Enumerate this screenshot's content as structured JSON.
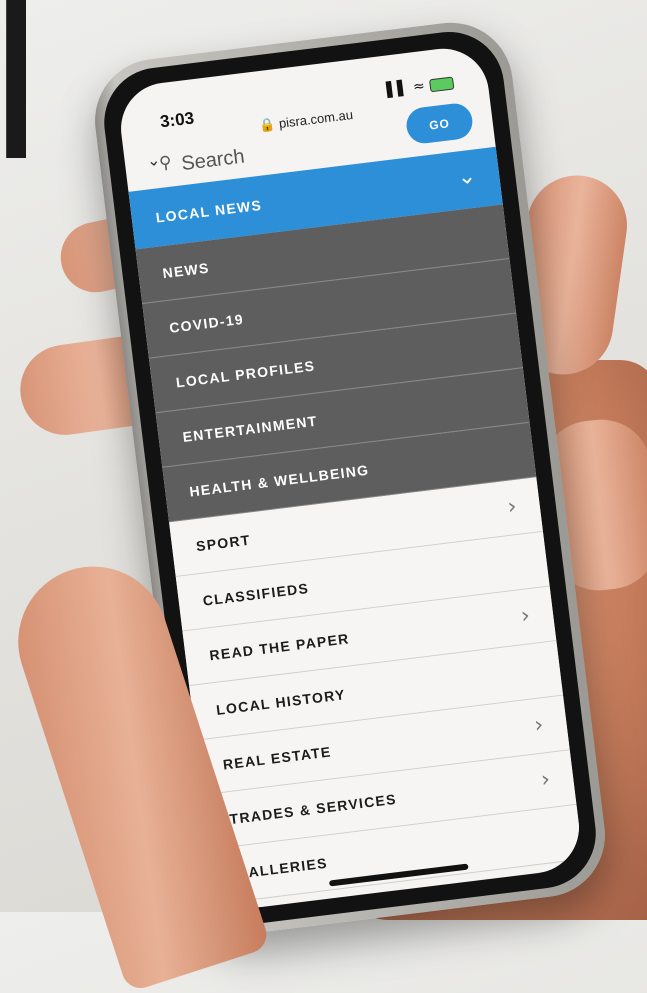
{
  "status_bar": {
    "time": "3:03",
    "url": "pisra.com.au"
  },
  "search": {
    "placeholder": "Search",
    "go_label": "GO"
  },
  "menu": {
    "items": [
      {
        "label": "LOCAL NEWS",
        "style": "active",
        "chevron": "chevron-down-icon"
      },
      {
        "label": "NEWS",
        "style": "dark"
      },
      {
        "label": "COVID-19",
        "style": "dark"
      },
      {
        "label": "LOCAL PROFILES",
        "style": "dark"
      },
      {
        "label": "ENTERTAINMENT",
        "style": "dark"
      },
      {
        "label": "HEALTH & WELLBEING",
        "style": "dark"
      },
      {
        "label": "SPORT",
        "style": "light",
        "chevron": "chevron-right-icon"
      },
      {
        "label": "CLASSIFIEDS",
        "style": "light"
      },
      {
        "label": "READ THE PAPER",
        "style": "light",
        "chevron": "chevron-right-icon"
      },
      {
        "label": "LOCAL HISTORY",
        "style": "light"
      },
      {
        "label": "REAL ESTATE",
        "style": "light",
        "chevron": "chevron-right-icon"
      },
      {
        "label": "TRADES & SERVICES",
        "style": "light",
        "chevron": "chevron-right-icon"
      },
      {
        "label": "GALLERIES",
        "style": "light"
      }
    ]
  },
  "colors": {
    "accent": "#2d8fd7",
    "submenu_bg": "#5e5e5e",
    "menu_bg": "#f6f5f3"
  }
}
